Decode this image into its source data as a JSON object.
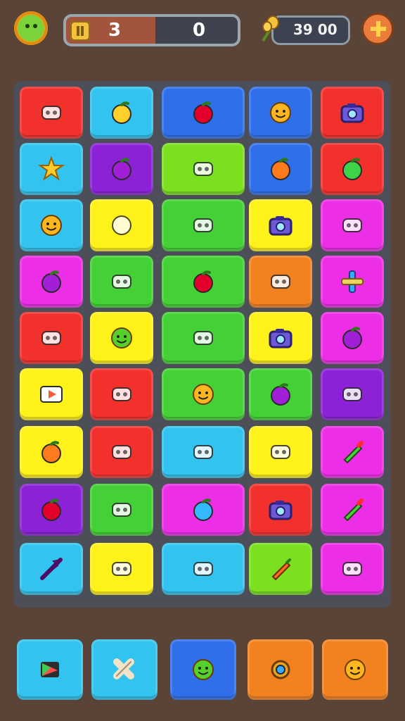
{
  "hud": {
    "score_left": "3",
    "score_right": "0",
    "coins": "39 00"
  },
  "colors": {
    "red": "#f2312d",
    "cyan": "#33c3ef",
    "blue": "#2f6fea",
    "lime": "#7be020",
    "green": "#44d135",
    "yellow": "#fff11a",
    "magenta": "#ec2ee6",
    "purple": "#8b22d6",
    "orange": "#f2821f"
  },
  "board": {
    "rows": [
      [
        {
          "color": "red",
          "icon": "fish-icon"
        },
        {
          "color": "cyan",
          "icon": "lemon-icon"
        },
        {
          "color": "blue",
          "icon": "apple-icon"
        },
        {
          "color": "blue",
          "icon": "smiley-fruit-icon"
        },
        {
          "color": "red",
          "icon": "camera-icon"
        }
      ],
      [
        {
          "color": "cyan",
          "icon": "star-icon"
        },
        {
          "color": "purple",
          "icon": "plum-icon"
        },
        {
          "color": "lime",
          "icon": "shovel-icon",
          "wide": true
        },
        {
          "color": "blue",
          "icon": "orange-icon"
        },
        {
          "color": "red",
          "icon": "lime-icon"
        }
      ],
      [
        {
          "color": "cyan",
          "icon": "smiley-orange-icon"
        },
        {
          "color": "yellow",
          "icon": "green-blob-icon"
        },
        {
          "color": "green",
          "icon": "grill-icon",
          "wide": true
        },
        {
          "color": "yellow",
          "icon": "camera-icon"
        },
        {
          "color": "magenta",
          "icon": "cheese-icon"
        }
      ],
      [
        {
          "color": "magenta",
          "icon": "eggplant-icon"
        },
        {
          "color": "green",
          "icon": "crate-icon"
        },
        {
          "color": "green",
          "icon": "apple-icon",
          "wide": true
        },
        {
          "color": "orange",
          "icon": "radio-icon"
        },
        {
          "color": "magenta",
          "icon": "cross-icon"
        }
      ],
      [
        {
          "color": "red",
          "icon": "screen-icon"
        },
        {
          "color": "yellow",
          "icon": "green-face-icon"
        },
        {
          "color": "green",
          "icon": "toolbox-icon",
          "wide": true
        },
        {
          "color": "yellow",
          "icon": "camera-icon"
        },
        {
          "color": "magenta",
          "icon": "plum-icon"
        }
      ],
      [
        {
          "color": "yellow",
          "icon": "play-icon"
        },
        {
          "color": "red",
          "icon": "taco-icon"
        },
        {
          "color": "green",
          "icon": "smiley-orange-icon",
          "wide": true
        },
        {
          "color": "green",
          "icon": "grape-icon"
        },
        {
          "color": "purple",
          "icon": "lollipop-icon"
        }
      ],
      [
        {
          "color": "yellow",
          "icon": "orange-icon"
        },
        {
          "color": "red",
          "icon": "knife-icon"
        },
        {
          "color": "cyan",
          "icon": "egg-icon",
          "wide": true
        },
        {
          "color": "yellow",
          "icon": "leaf-icon"
        },
        {
          "color": "magenta",
          "icon": "crayon-icon"
        }
      ],
      [
        {
          "color": "purple",
          "icon": "strawberry-icon"
        },
        {
          "color": "green",
          "icon": "radio-icon"
        },
        {
          "color": "magenta",
          "icon": "balloon-icon",
          "wide": true
        },
        {
          "color": "red",
          "icon": "camera-icon"
        },
        {
          "color": "magenta",
          "icon": "pencil-icon"
        }
      ],
      [
        {
          "color": "cyan",
          "icon": "arrow-icon"
        },
        {
          "color": "yellow",
          "icon": "chili-icon"
        },
        {
          "color": "cyan",
          "icon": "frog-icon",
          "wide": true
        },
        {
          "color": "lime",
          "icon": "carrot-icon"
        },
        {
          "color": "magenta",
          "icon": "sun-icon"
        }
      ]
    ]
  },
  "dock": {
    "items": [
      {
        "color": "cyan",
        "icon": "prism-icon"
      },
      {
        "color": "cyan",
        "icon": "bandage-icon"
      },
      {
        "color": "blue",
        "icon": "green-face-icon"
      },
      {
        "color": "orange",
        "icon": "gear-icon"
      },
      {
        "color": "orange",
        "icon": "smiley-icon"
      }
    ]
  }
}
